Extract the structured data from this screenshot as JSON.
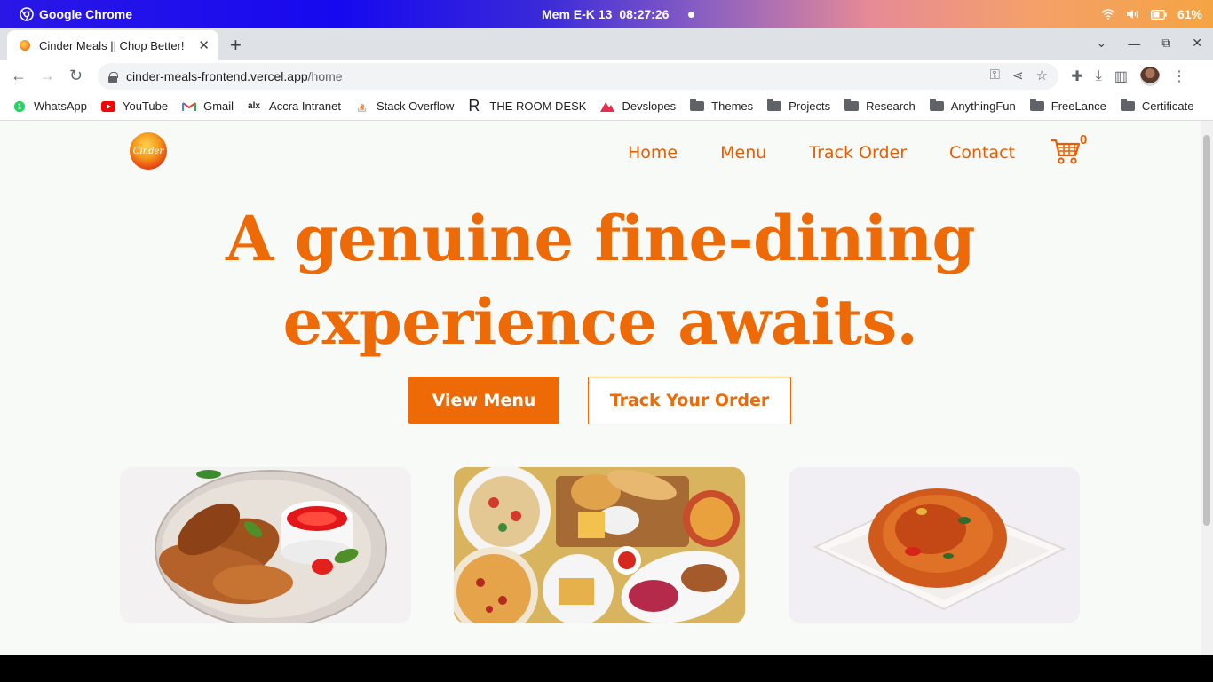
{
  "os": {
    "app_name": "Google Chrome",
    "status": "Mem E-K 13",
    "time": "08:27:26",
    "battery": "61%"
  },
  "browser": {
    "tab_title": "Cinder Meals || Chop Better!",
    "url_host": "cinder-meals-frontend.vercel.app",
    "url_path": "/home",
    "bookmarks": [
      "WhatsApp",
      "YouTube",
      "Gmail",
      "Accra Intranet",
      "Stack Overflow",
      "THE ROOM DESK",
      "Devslopes",
      "Themes",
      "Projects",
      "Research",
      "AnythingFun",
      "FreeLance",
      "Certificate"
    ]
  },
  "site": {
    "logo_text": "Cinder",
    "nav": [
      "Home",
      "Menu",
      "Track Order",
      "Contact"
    ],
    "cart_count": "0",
    "hero_line1": "A genuine fine-dining",
    "hero_line2": "experience awaits.",
    "cta_primary": "View Menu",
    "cta_secondary": "Track Your Order",
    "accent_color": "#ee6a06"
  }
}
